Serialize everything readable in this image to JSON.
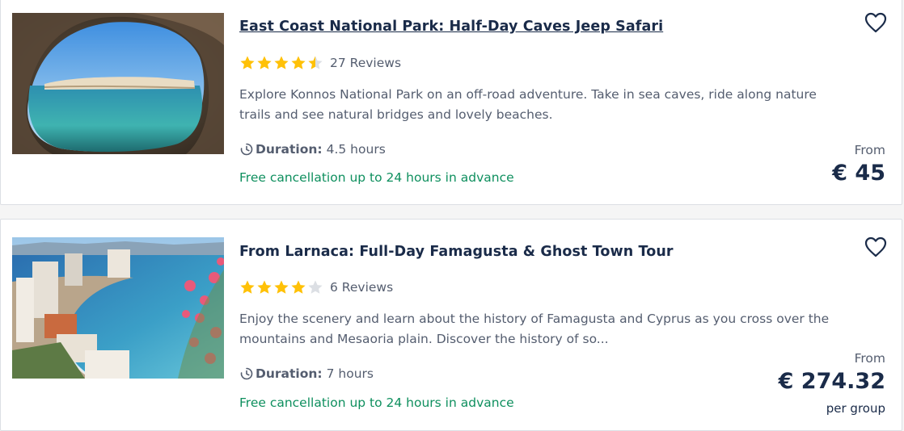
{
  "activities": [
    {
      "title": "East Coast National Park: Half-Day Caves Jeep Safari",
      "rating": 4.5,
      "reviews_label": "27 Reviews",
      "description": "Explore Konnos National Park on an off-road adventure. Take in sea caves, ride along nature trails and see natural bridges and lovely beaches.",
      "duration_label": "Duration:",
      "duration_value": "4.5 hours",
      "cancellation": "Free cancellation up to 24 hours in advance",
      "from_label": "From",
      "price": "€ 45",
      "image_alt": "sea cave view"
    },
    {
      "title": "From Larnaca: Full-Day Famagusta & Ghost Town Tour",
      "rating": 4,
      "reviews_label": "6 Reviews",
      "description": "Enjoy the scenery and learn about the history of Famagusta and Cyprus as you cross over the mountains and Mesaoria plain. Discover the history of so...",
      "duration_label": "Duration:",
      "duration_value": "7 hours",
      "cancellation": "Free cancellation up to 24 hours in advance",
      "from_label": "From",
      "price": "€ 274.32",
      "price_unit": "per group",
      "image_alt": "coastal town view"
    }
  ],
  "icons": {
    "wishlist": "heart-icon",
    "duration": "clock-icon",
    "rating": "star-icon"
  },
  "colors": {
    "title": "#1a2b49",
    "body_text": "#545d6f",
    "cancellation": "#0e8f5e",
    "star_filled": "#ffc107",
    "star_empty": "#dcdfe4"
  }
}
